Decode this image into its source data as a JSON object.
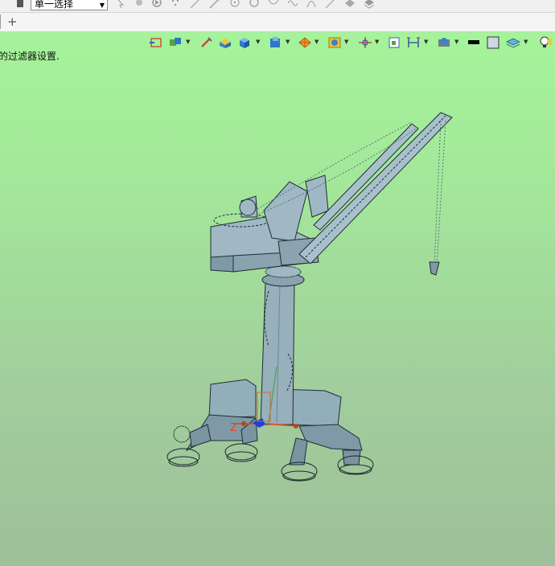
{
  "toolbar_top": {
    "selection_filter_value": "单一选择",
    "icons": [
      "box-select-icon",
      "lasso-icon",
      "snap-icon",
      "point-icon",
      "line-icon",
      "arrow-line-icon",
      "circle-point-icon",
      "circle-icon",
      "vertex-icon",
      "curve-icon",
      "arc-icon",
      "tangent-icon",
      "hatch-icon",
      "layer-icon"
    ]
  },
  "tabs": {
    "add_label": "+"
  },
  "status": {
    "message": "的过滤器设置."
  },
  "view_toolbar": {
    "icons": [
      "fit-view-icon",
      "views-dropdown-icon",
      "pan-icon",
      "box-view-icon",
      "shaded-cube-icon",
      "display-style-icon",
      "orient-icon",
      "section-icon",
      "clip-icon",
      "hide-box-icon",
      "snap-grid-icon",
      "background-color-icon",
      "edge-color-icon",
      "layer-settings-icon",
      "light-bulb-icon"
    ]
  },
  "viewport": {
    "background_top": "#a5f69a",
    "background_bottom": "#9fbf9a",
    "model_color": "#8ea9b5"
  }
}
